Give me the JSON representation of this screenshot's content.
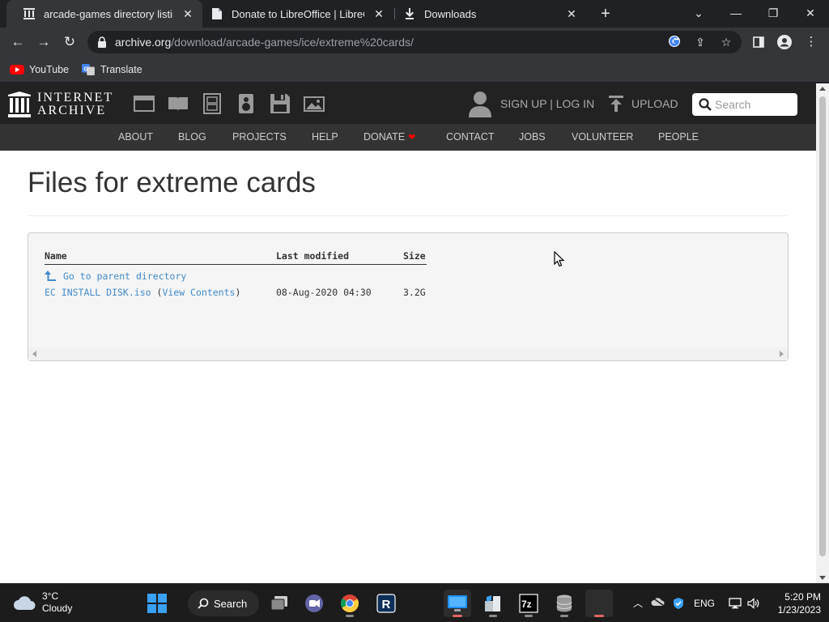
{
  "browser": {
    "tabs": [
      {
        "title": "arcade-games directory listing",
        "active": true
      },
      {
        "title": "Donate to LibreOffice | LibreOffic",
        "active": false
      },
      {
        "title": "Downloads",
        "active": false
      }
    ],
    "url_host": "archive.org",
    "url_path": "/download/arcade-games/ice/extreme%20cards/",
    "bookmarks": [
      {
        "label": "YouTube",
        "icon": "youtube-icon"
      },
      {
        "label": "Translate",
        "icon": "google-translate-icon"
      }
    ]
  },
  "ia": {
    "logo_line1": "INTERNET",
    "logo_line2": "ARCHIVE",
    "signup_login": "SIGN UP | LOG IN",
    "upload": "UPLOAD",
    "search_placeholder": "Search",
    "nav": [
      "ABOUT",
      "BLOG",
      "PROJECTS",
      "HELP",
      "DONATE",
      "CONTACT",
      "JOBS",
      "VOLUNTEER",
      "PEOPLE"
    ],
    "heart": "❤"
  },
  "page": {
    "title": "Files for extreme cards",
    "columns": {
      "name": "Name",
      "modified": "Last modified",
      "size": "Size"
    },
    "parent_link": "Go to parent directory",
    "files": [
      {
        "name": "EC INSTALL DISK.iso",
        "open_paren": "(",
        "view": "View Contents",
        "close_paren": ")",
        "modified": "08-Aug-2020 04:30",
        "size": "3.2G"
      }
    ]
  },
  "taskbar": {
    "temperature": "3°C",
    "condition": "Cloudy",
    "search_label": "Search",
    "language": "ENG",
    "time": "5:20 PM",
    "date": "1/23/2023"
  },
  "colors": {
    "link": "#428bca",
    "ia_header": "#222222",
    "ia_nav": "#333333",
    "donate_heart": "#ff0000"
  }
}
